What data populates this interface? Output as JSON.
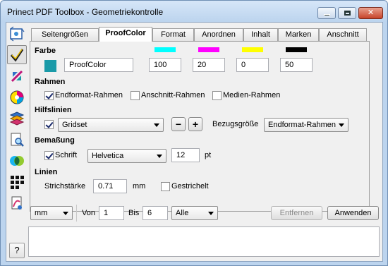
{
  "window": {
    "title": "Prinect PDF Toolbox - Geometriekontrolle"
  },
  "sidebar": {
    "tools": [
      {
        "icon": "measure-tool-icon"
      },
      {
        "icon": "checkmark-tool-icon"
      },
      {
        "icon": "transform-tool-icon"
      },
      {
        "icon": "color-wheel-tool-icon"
      },
      {
        "icon": "layers-tool-icon"
      },
      {
        "icon": "magnifier-document-icon"
      },
      {
        "icon": "overprint-circles-icon"
      },
      {
        "icon": "grid-blocks-icon"
      },
      {
        "icon": "document-curve-icon"
      }
    ],
    "help_label": "?"
  },
  "tabs": [
    {
      "label": "Seitengrößen"
    },
    {
      "label": "ProofColor",
      "active": true
    },
    {
      "label": "Format"
    },
    {
      "label": "Anordnen"
    },
    {
      "label": "Inhalt"
    },
    {
      "label": "Marken"
    },
    {
      "label": "Anschnitt"
    }
  ],
  "farbe": {
    "title": "Farbe",
    "color_name": "ProofColor",
    "preview_color": "#1a9aa8",
    "channels": [
      {
        "name": "cyan",
        "color": "#00ffff",
        "value": "100"
      },
      {
        "name": "magenta",
        "color": "#ff00ff",
        "value": "20"
      },
      {
        "name": "yellow",
        "color": "#ffff00",
        "value": "0"
      },
      {
        "name": "black",
        "color": "#000000",
        "value": "50"
      }
    ]
  },
  "rahmen": {
    "title": "Rahmen",
    "endformat": {
      "label": "Endformat-Rahmen",
      "checked": true
    },
    "anschnitt": {
      "label": "Anschnitt-Rahmen",
      "checked": false
    },
    "medien": {
      "label": "Medien-Rahmen",
      "checked": false
    }
  },
  "hilfslinien": {
    "title": "Hilfslinien",
    "checked": true,
    "grid_select": "Gridset",
    "minus": "−",
    "plus": "+",
    "bezug_label": "Bezugsgröße",
    "bezug_select": "Endformat-Rahmen"
  },
  "bemassung": {
    "title": "Bemaßung",
    "schrift_label": "Schrift",
    "schrift_checked": true,
    "font_select": "Helvetica",
    "size_value": "12",
    "size_unit": "pt"
  },
  "linien": {
    "title": "Linien",
    "staerke_label": "Strichstärke",
    "staerke_value": "0.71",
    "staerke_unit": "mm",
    "gestrichelt_label": "Gestrichelt",
    "gestrichelt_checked": false
  },
  "footer": {
    "unit_select": "mm",
    "von_label": "Von",
    "von_value": "1",
    "bis_label": "Bis",
    "bis_value": "6",
    "range_select": "Alle",
    "entfernen_label": "Entfernen",
    "anwenden_label": "Anwenden"
  }
}
